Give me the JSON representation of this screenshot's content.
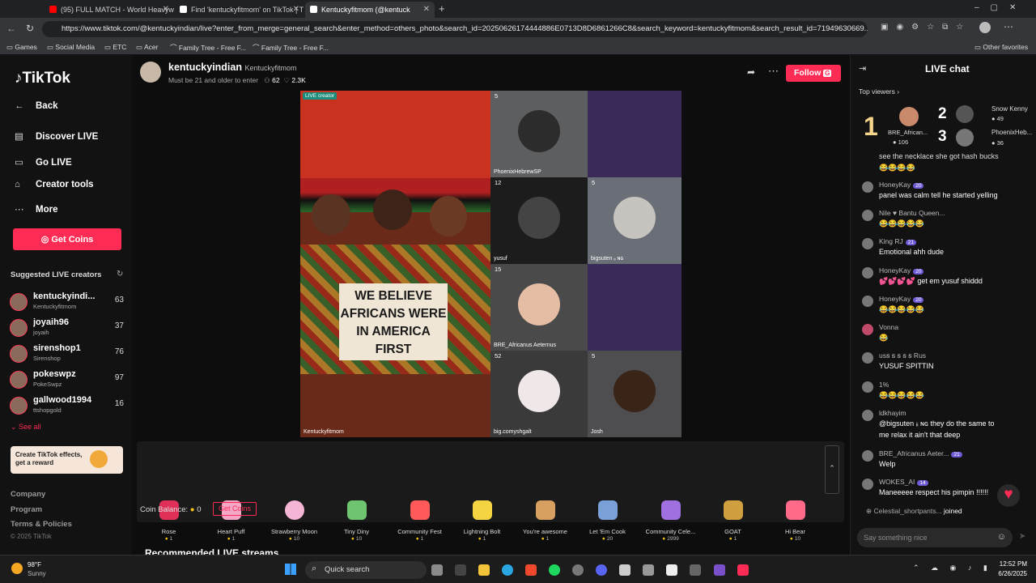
{
  "browser": {
    "tabs": [
      {
        "label": "(95) FULL MATCH - World Heavyweig",
        "active": false,
        "color": "#ff0000"
      },
      {
        "label": "Find 'kentuckyfitmom' on TikTok | T",
        "active": false,
        "color": "#ffffff"
      },
      {
        "label": "Kentuckyfitmom (@kentuck",
        "active": true,
        "color": "#ffffff"
      }
    ],
    "url": "https://www.tiktok.com/@kentuckyindian/live?enter_from_merge=general_search&enter_method=others_photo&search_id=20250626174444886E0713D8D6861266C8&search_keyword=kentuckyfitmom&search_result_id=71949630669...",
    "bookmarks": [
      "Games",
      "Social Media",
      "ETC",
      "Acer",
      "Family Tree - Free F...",
      "Family Tree - Free F..."
    ],
    "other_favorites": "Other favorites"
  },
  "sidebar": {
    "logo": "TikTok",
    "nav": [
      {
        "label": "Back",
        "icon": "arrow-left-icon"
      },
      {
        "label": "Discover LIVE",
        "icon": "live-icon"
      },
      {
        "label": "Go LIVE",
        "icon": "camera-icon"
      },
      {
        "label": "Creator tools",
        "icon": "home-icon"
      },
      {
        "label": "More",
        "icon": "dots-icon"
      }
    ],
    "get_coins": "Get Coins",
    "suggested_title": "Suggested LIVE creators",
    "suggested": [
      {
        "name": "kentuckyindi...",
        "sub": "Kentuckyfitmom",
        "count": "63"
      },
      {
        "name": "joyaih96",
        "sub": "joyaih",
        "count": "37"
      },
      {
        "name": "sirenshop1",
        "sub": "Sirenshop",
        "count": "76"
      },
      {
        "name": "pokeswpz",
        "sub": "PokeSwpz",
        "count": "97"
      },
      {
        "name": "gallwood1994",
        "sub": "ttshopgold",
        "count": "16"
      }
    ],
    "see_all": "See all",
    "effects_banner": "Create TikTok effects, get a reward",
    "footer": [
      "Company",
      "Program",
      "Terms & Policies",
      "© 2025 TikTok"
    ]
  },
  "live_header": {
    "host": "kentuckyindian",
    "host_sub": "Kentuckyfitmom",
    "notice": "Must be 21 and older to enter",
    "viewers": "62",
    "likes": "2.3K",
    "follow": "Follow",
    "follow_key": "G"
  },
  "stream": {
    "creator_tag": "LIVE creator",
    "main_label": "Kentuckyfitmom",
    "sign_text": "WE BELIEVE AFRICANS WERE IN AMERICA FIRST",
    "guests": [
      {
        "count": "5",
        "label": "PhoenixHebrewSP"
      },
      {
        "count": "",
        "label": ""
      },
      {
        "count": "12",
        "label": "yusuf"
      },
      {
        "count": "5",
        "label": "bigsuten ᵢᵢ ɴɢ"
      },
      {
        "count": "15",
        "label": "BRE_Africanus Aeternus"
      },
      {
        "count": "",
        "label": ""
      },
      {
        "count": "52",
        "label": "big.comyshgalt"
      },
      {
        "count": "5",
        "label": "Josh"
      }
    ]
  },
  "gifts": [
    {
      "name": "Rose",
      "price": "1",
      "color": "#e0305a"
    },
    {
      "name": "Heart Puff",
      "price": "1",
      "color": "#f4a6c6"
    },
    {
      "name": "Strawberry Moon",
      "price": "10",
      "color": "#f5b5d5"
    },
    {
      "name": "Tiny Diny",
      "price": "10",
      "color": "#6fc46f"
    },
    {
      "name": "Community Fest",
      "price": "1",
      "color": "#ff5a5a"
    },
    {
      "name": "Lightning Bolt",
      "price": "1",
      "color": "#f5d442"
    },
    {
      "name": "You're awesome",
      "price": "1",
      "color": "#d8a060"
    },
    {
      "name": "Let 'Em Cook",
      "price": "20",
      "color": "#7aa0d8"
    },
    {
      "name": "Community Cele...",
      "price": "2999",
      "color": "#a070e0"
    },
    {
      "name": "GOAT",
      "price": "1",
      "color": "#d0a040"
    },
    {
      "name": "Hi Bear",
      "price": "10",
      "color": "#ff6a8a"
    }
  ],
  "coin_balance": {
    "label": "Coin Balance:",
    "value": "0",
    "get_coins": "Get Coins"
  },
  "recommended": "Recommended LIVE streams",
  "chat": {
    "title": "LIVE chat",
    "top_viewers_label": "Top viewers",
    "top_viewers": [
      {
        "rank": "1",
        "name": "BRE_African...",
        "score": "106"
      },
      {
        "rank": "2",
        "name": "Snow Kenny",
        "score": "49"
      },
      {
        "rank": "3",
        "name": "PhoenixHeb...",
        "score": "36"
      }
    ],
    "messages": [
      {
        "user": "",
        "badge": "",
        "text": "see the necklace she got hash bucks"
      },
      {
        "user": "",
        "badge": "",
        "text": "😂😂😂😂"
      },
      {
        "user": "HoneyKay",
        "badge": "20",
        "text": "panel was calm tell he started yelling"
      },
      {
        "user": "Nile ♥ Bantu Queen...",
        "badge": "",
        "text": "😂😂😂😂😂"
      },
      {
        "user": "King RJ",
        "badge": "21",
        "text": "Emotional ahh dude"
      },
      {
        "user": "HoneyKay",
        "badge": "20",
        "text": "💕💕💕💕 get em yusuf shiddd"
      },
      {
        "user": "HoneyKay",
        "badge": "20",
        "text": "😂😂😂😂😂"
      },
      {
        "user": "Vonna",
        "badge": "",
        "text": "😂"
      },
      {
        "user": "usꞩ ꞩ ꞩ ꞩ ꞩ Rus",
        "badge": "",
        "text": "YUSUF SPITTIN"
      },
      {
        "user": "1%",
        "badge": "",
        "text": "😂😂😂😂😂"
      },
      {
        "user": "ldkhayim",
        "badge": "",
        "text": "@bigsuten ᵢᵢ ɴɢ they do the same to"
      },
      {
        "user": "",
        "badge": "",
        "text": "me relax it ain't that deep"
      },
      {
        "user": "BRE_Africanus Aeter...",
        "badge": "21",
        "text": "Welp"
      },
      {
        "user": "WOKES_AI",
        "badge": "14",
        "text": "Maneeeee respect his pimpin !!!!!!"
      },
      {
        "user": "Celestial_shortpants...",
        "badge": "",
        "text": "joined"
      }
    ],
    "input_placeholder": "Say something nice"
  },
  "taskbar": {
    "weather_temp": "98°F",
    "weather_desc": "Sunny",
    "search": "Quick search",
    "time": "12:52 PM",
    "date": "6/26/2025"
  }
}
